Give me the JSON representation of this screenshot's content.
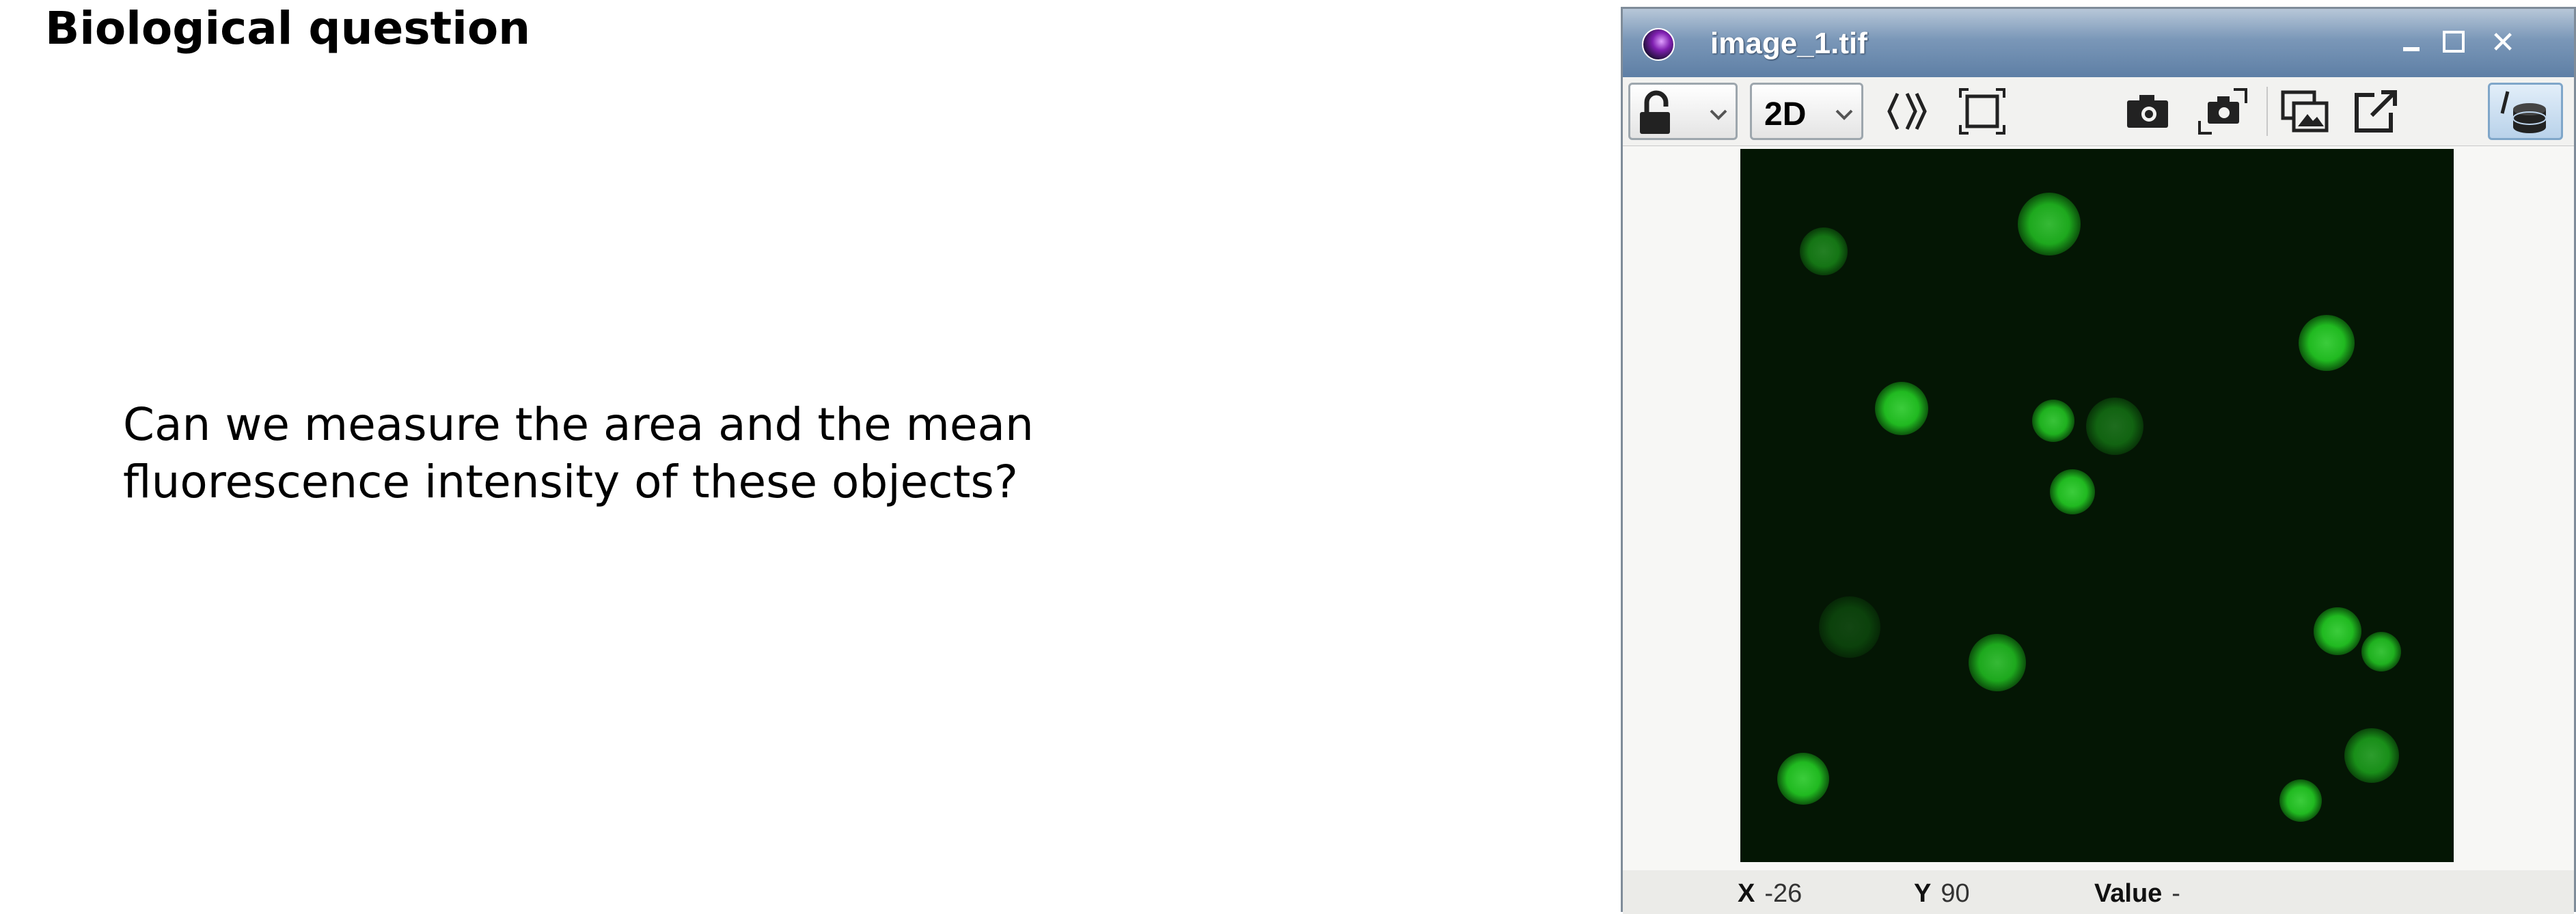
{
  "slide": {
    "title": "Biological question",
    "question_lines": [
      "Can we measure the area and the mean",
      "fluorescence intensity of these objects?"
    ]
  },
  "viewer": {
    "window_title": "image_1.tif",
    "controls": {
      "minimize": "minimize",
      "maximize": "maximize",
      "close": "✕"
    },
    "toolbar": {
      "lock_icon": "lock-open-icon",
      "view_mode": "2D",
      "icons": [
        "lock-open-icon",
        "chevron-down-icon",
        "zoom-step-icon",
        "fit-to-window-icon",
        "screenshot-icon",
        "screenshot-original-icon",
        "duplicate-icon",
        "detach-icon",
        "layers-icon"
      ]
    },
    "status": {
      "x_label": "X",
      "x_value": "-26",
      "y_label": "Y",
      "y_value": "90",
      "value_label": "Value",
      "value_value": "-"
    },
    "colors": {
      "image_background": "#041604",
      "fluorescence": "#22c222",
      "titlebar": "#6a89ad"
    }
  }
}
